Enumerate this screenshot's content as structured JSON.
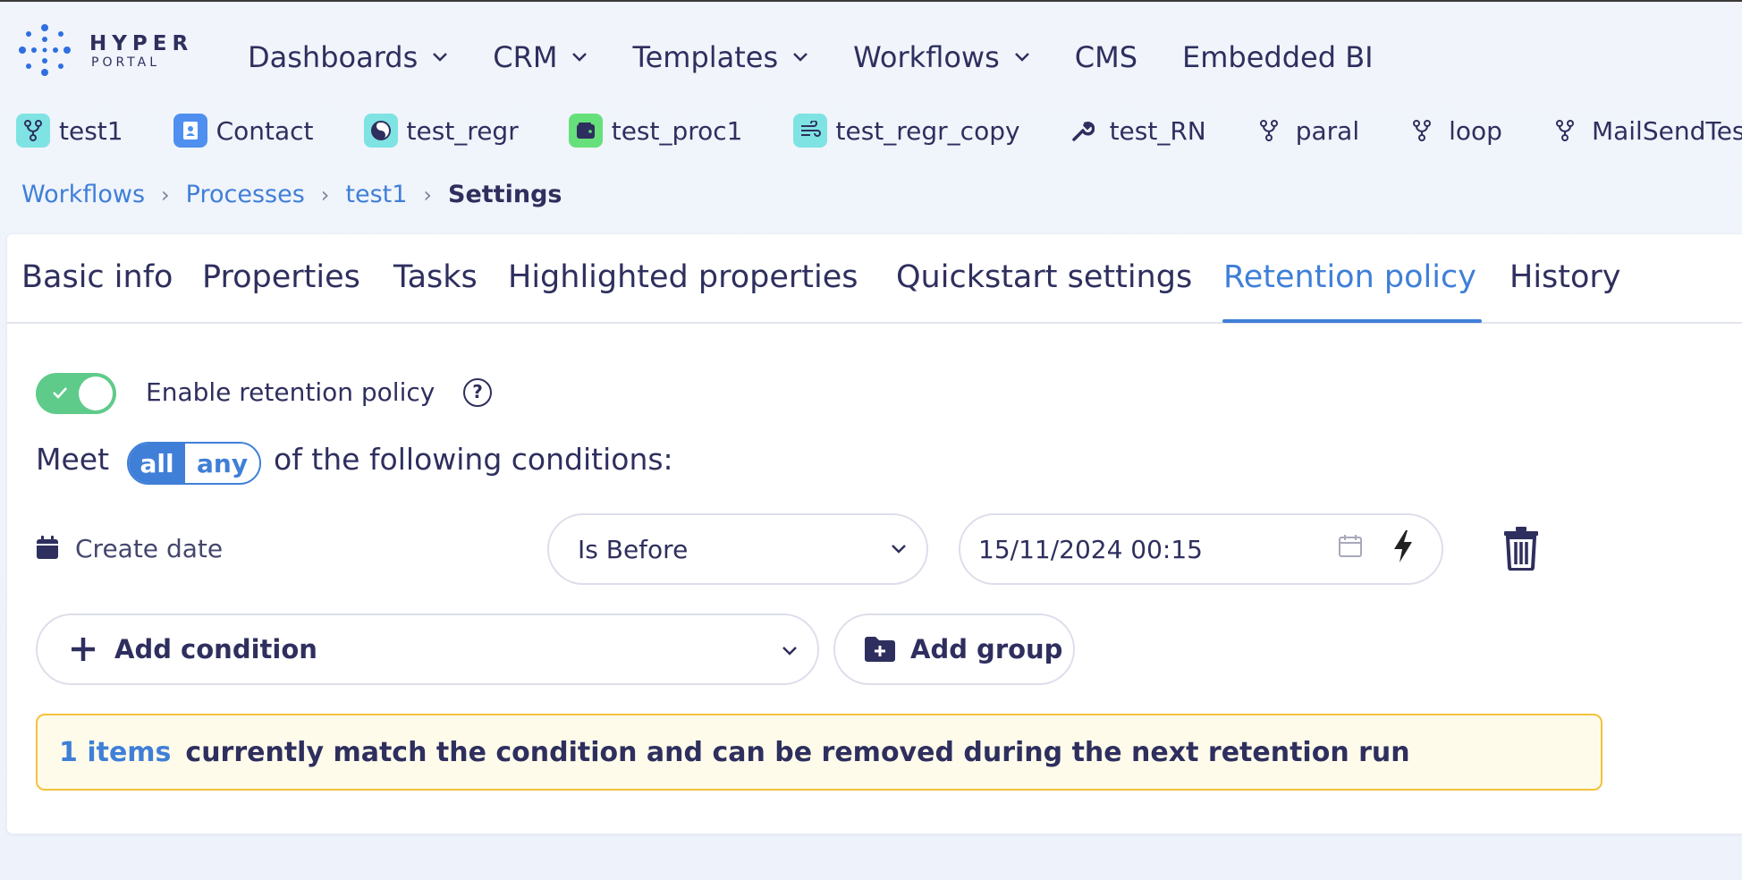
{
  "brand": {
    "name": "HYPER",
    "sub": "PORTAL"
  },
  "menu": [
    {
      "label": "Dashboards",
      "dropdown": true
    },
    {
      "label": "CRM",
      "dropdown": true
    },
    {
      "label": "Templates",
      "dropdown": true
    },
    {
      "label": "Workflows",
      "dropdown": true
    },
    {
      "label": "CMS",
      "dropdown": false
    },
    {
      "label": "Embedded BI",
      "dropdown": false
    }
  ],
  "shortcuts": [
    {
      "label": "test1",
      "icon": "fork-icon",
      "bg": "#7fe3e3"
    },
    {
      "label": "Contact",
      "icon": "contact-card-icon",
      "bg": "#4f8ff0"
    },
    {
      "label": "test_regr",
      "icon": "yin-yang-icon",
      "bg": "#7fe3e3"
    },
    {
      "label": "test_proc1",
      "icon": "wallet-icon",
      "bg": "#66e07a"
    },
    {
      "label": "test_regr_copy",
      "icon": "wind-icon",
      "bg": "#7fe3e3"
    },
    {
      "label": "test_RN",
      "icon": "wrench-icon",
      "bg": ""
    },
    {
      "label": "paral",
      "icon": "fork-icon",
      "bg": ""
    },
    {
      "label": "loop",
      "icon": "fork-icon",
      "bg": ""
    },
    {
      "label": "MailSendTest",
      "icon": "fork-icon",
      "bg": ""
    }
  ],
  "breadcrumb": {
    "items": [
      "Workflows",
      "Processes",
      "test1"
    ],
    "current": "Settings"
  },
  "tabs": [
    {
      "label": "Basic info",
      "active": false
    },
    {
      "label": "Properties",
      "active": false
    },
    {
      "label": "Tasks",
      "active": false
    },
    {
      "label": "Highlighted properties",
      "active": false
    },
    {
      "label": "Quickstart settings",
      "active": false
    },
    {
      "label": "Retention policy",
      "active": true
    },
    {
      "label": "History",
      "active": false
    }
  ],
  "retention": {
    "enabled": true,
    "enable_label": "Enable retention policy",
    "help": "?",
    "meet_label": "Meet",
    "match_all": "all",
    "match_any": "any",
    "match_selected": "all",
    "following_label": "of the following conditions:",
    "condition": {
      "field": "Create date",
      "operator": "Is Before",
      "value": "15/11/2024 00:15"
    },
    "add_condition_label": "Add condition",
    "add_group_label": "Add group",
    "info_count": "1 items",
    "info_text": "currently match the condition and can be removed during the next retention run"
  },
  "colors": {
    "accent": "#3f7fd8",
    "toggle_on": "#5fcb8a",
    "warning_border": "#f2c23c",
    "warning_bg": "#fefbea",
    "text": "#2e2f5e"
  }
}
